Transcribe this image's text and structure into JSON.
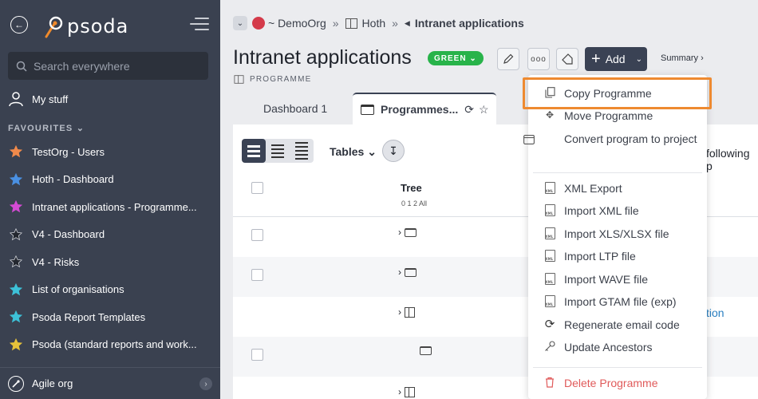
{
  "sidebar": {
    "logo_text": "psoda",
    "search_placeholder": "Search everywhere",
    "my_stuff": "My stuff",
    "favourites_heading": "FAVOURITES",
    "favourites": [
      {
        "label": "TestOrg - Users",
        "color": "#f08a4b"
      },
      {
        "label": "Hoth - Dashboard",
        "color": "#4a90e2"
      },
      {
        "label": "Intranet applications - Programme...",
        "color": "#d44bd4"
      },
      {
        "label": "V4 - Dashboard",
        "color": "#23272f"
      },
      {
        "label": "V4 - Risks",
        "color": "#23272f"
      },
      {
        "label": "List of organisations",
        "color": "#3dc1d8"
      },
      {
        "label": "Psoda Report Templates",
        "color": "#3dc1d8"
      },
      {
        "label": "Psoda (standard reports and work...",
        "color": "#e6c23a"
      }
    ],
    "bottom_org": "Agile org"
  },
  "breadcrumb": {
    "org": "~ DemoOrg",
    "parent": "Hoth",
    "current": "Intranet applications"
  },
  "header": {
    "title": "Intranet applications",
    "status": "GREEN",
    "type": "PROGRAMME",
    "add_label": "Add",
    "summary_label": "Summary ›"
  },
  "tabs": [
    {
      "label": "Dashboard 1"
    },
    {
      "label": "Programmes..."
    }
  ],
  "panel": {
    "tables_label": "Tables",
    "tree_header": "Tree",
    "tree_levels": "0 1 2 All",
    "partial_text_right": "following p",
    "partial_link_right": "tion"
  },
  "menu": {
    "items": [
      {
        "label": "Copy Programme",
        "icon": "copy-icon"
      },
      {
        "label": "Move Programme",
        "icon": "move-icon"
      },
      {
        "label": "Convert program to project",
        "icon": "convert-icon"
      },
      {
        "label": "XML Export",
        "icon": "xml-file-icon"
      },
      {
        "label": "Import XML file",
        "icon": "xml-file-icon"
      },
      {
        "label": "Import XLS/XLSX file",
        "icon": "xml-file-icon"
      },
      {
        "label": "Import LTP file",
        "icon": "xml-file-icon"
      },
      {
        "label": "Import WAVE file",
        "icon": "xml-file-icon"
      },
      {
        "label": "Import GTAM file (exp)",
        "icon": "xml-file-icon"
      },
      {
        "label": "Regenerate email code",
        "icon": "refresh-icon"
      },
      {
        "label": "Update Ancestors",
        "icon": "key-icon"
      },
      {
        "label": "Delete Programme",
        "icon": "trash-icon"
      }
    ]
  },
  "colors": {
    "sidebar_bg": "#3a4150",
    "accent_dark": "#3a4254",
    "status_green": "#28b34a",
    "highlight_orange": "#ee8a30",
    "danger": "#e05a5a"
  }
}
